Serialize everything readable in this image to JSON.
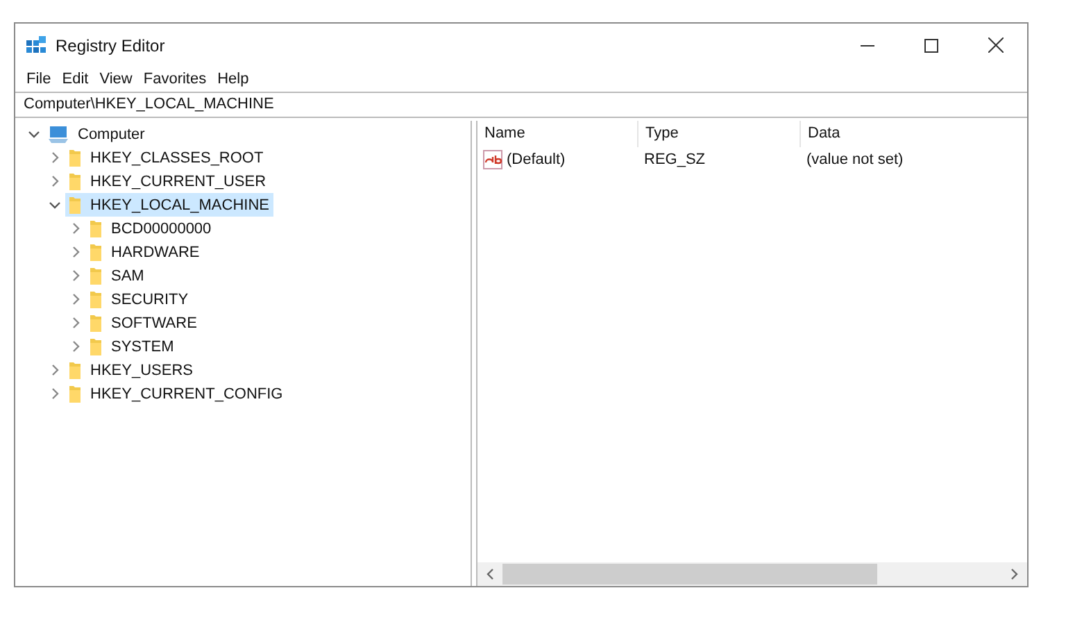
{
  "window": {
    "title": "Registry Editor"
  },
  "menu": [
    "File",
    "Edit",
    "View",
    "Favorites",
    "Help"
  ],
  "address": "Computer\\HKEY_LOCAL_MACHINE",
  "tree": [
    {
      "label": "Computer",
      "kind": "computer",
      "expanded": true,
      "selected": false,
      "children": [
        {
          "label": "HKEY_CLASSES_ROOT",
          "kind": "folder",
          "expanded": false,
          "selected": false
        },
        {
          "label": "HKEY_CURRENT_USER",
          "kind": "folder",
          "expanded": false,
          "selected": false
        },
        {
          "label": "HKEY_LOCAL_MACHINE",
          "kind": "folder",
          "expanded": true,
          "selected": true,
          "children": [
            {
              "label": "BCD00000000",
              "kind": "folder",
              "expanded": false,
              "selected": false
            },
            {
              "label": "HARDWARE",
              "kind": "folder",
              "expanded": false,
              "selected": false
            },
            {
              "label": "SAM",
              "kind": "folder",
              "expanded": false,
              "selected": false
            },
            {
              "label": "SECURITY",
              "kind": "folder",
              "expanded": false,
              "selected": false
            },
            {
              "label": "SOFTWARE",
              "kind": "folder",
              "expanded": false,
              "selected": false
            },
            {
              "label": "SYSTEM",
              "kind": "folder",
              "expanded": false,
              "selected": false
            }
          ]
        },
        {
          "label": "HKEY_USERS",
          "kind": "folder",
          "expanded": false,
          "selected": false
        },
        {
          "label": "HKEY_CURRENT_CONFIG",
          "kind": "folder",
          "expanded": false,
          "selected": false
        }
      ]
    }
  ],
  "list": {
    "columns": [
      "Name",
      "Type",
      "Data"
    ],
    "rows": [
      {
        "kind": "string",
        "cells": [
          "(Default)",
          "REG_SZ",
          "(value not set)"
        ]
      }
    ]
  }
}
